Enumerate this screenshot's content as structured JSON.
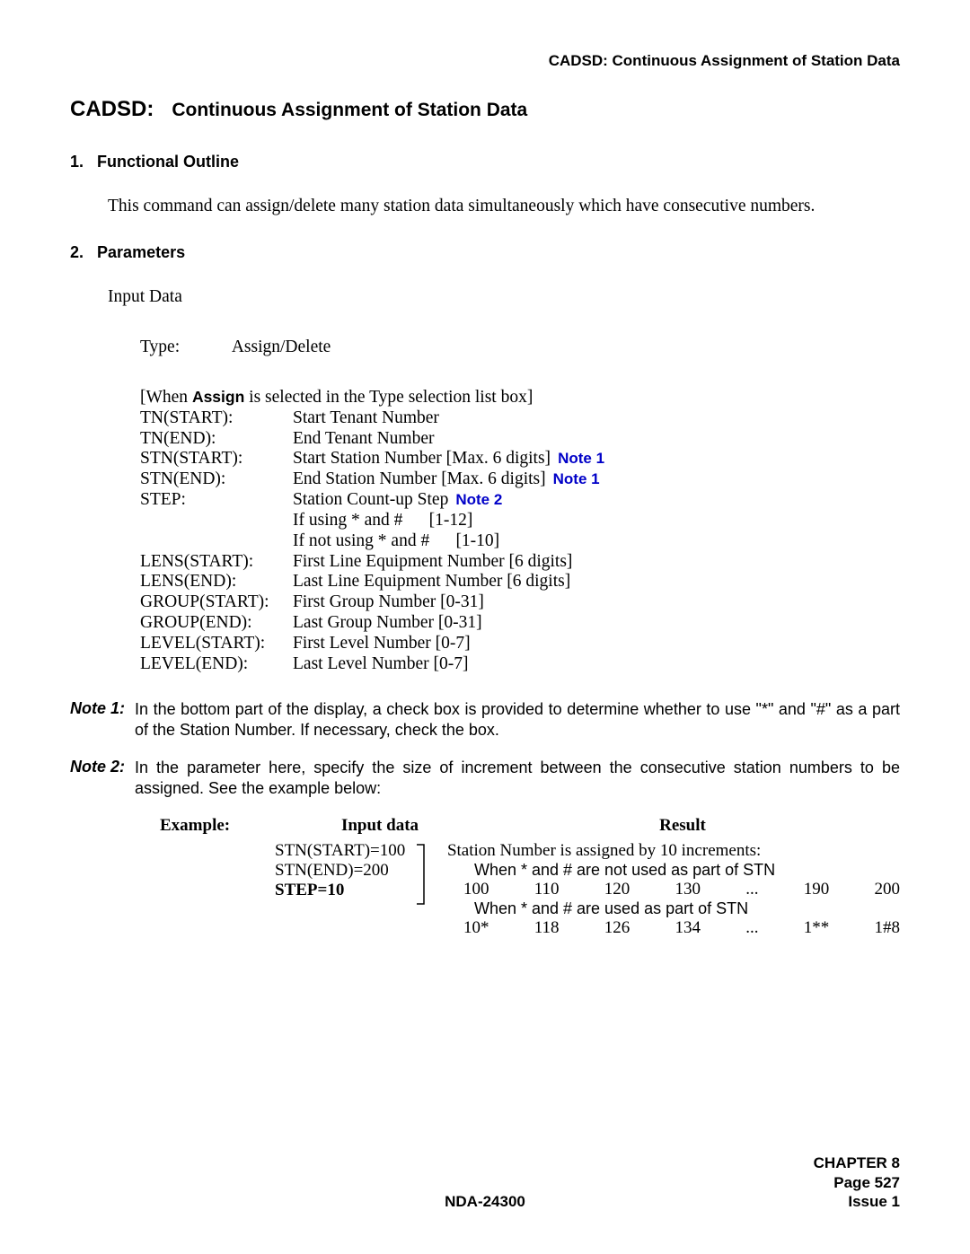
{
  "header": {
    "right": "CADSD: Continuous Assignment of Station Data"
  },
  "title": {
    "code": "CADSD:",
    "desc": "Continuous Assignment of Station Data"
  },
  "section1": {
    "num": "1.",
    "heading": "Functional Outline",
    "body": "This command can assign/delete many station data simultaneously which have consecutive numbers."
  },
  "section2": {
    "num": "2.",
    "heading": "Parameters",
    "input_label": "Input Data",
    "type_label": "Type:",
    "type_value": "Assign/Delete",
    "assign_line_prefix": "[When ",
    "assign_bold": "Assign",
    "assign_line_suffix": " is selected in the Type selection list box]"
  },
  "params": [
    {
      "name": "TN(START):",
      "desc": "Start Tenant Number",
      "note": ""
    },
    {
      "name": "TN(END):",
      "desc": "End Tenant Number",
      "note": ""
    },
    {
      "name": "STN(START):",
      "desc": "Start Station Number [Max. 6 digits]",
      "note": "Note 1"
    },
    {
      "name": "STN(END):",
      "desc": "End Station Number [Max. 6 digits]",
      "note": "Note 1"
    },
    {
      "name": "STEP:",
      "desc": "Station Count-up Step",
      "note": "Note 2"
    }
  ],
  "step_sub1": "If using * and #      [1-12]",
  "step_sub2": "If not using * and #      [1-10]",
  "params2": [
    {
      "name": "LENS(START):",
      "desc": "First Line Equipment Number [6 digits]"
    },
    {
      "name": "LENS(END):",
      "desc": "Last Line Equipment Number [6 digits]"
    },
    {
      "name": "GROUP(START):",
      "desc": "First Group Number [0-31]"
    },
    {
      "name": "GROUP(END):",
      "desc": "Last Group Number [0-31]"
    },
    {
      "name": "LEVEL(START):",
      "desc": "First Level Number [0-7]"
    },
    {
      "name": "LEVEL(END):",
      "desc": "Last Level Number [0-7]"
    }
  ],
  "note1": {
    "label": "Note 1:",
    "text": "In the bottom part of the display, a check box is provided to determine whether to use \"*\" and \"#\" as a part of the Station Number. If necessary, check the box."
  },
  "note2": {
    "label": "Note 2:",
    "text": "In the parameter here, specify the size of increment between the consecutive station numbers to be assigned. See the example below:"
  },
  "example": {
    "label": "Example:",
    "input_head": "Input data",
    "result_head": "Result",
    "input1": "STN(START)=100",
    "input2": "STN(END)=200",
    "input3": "STEP=10",
    "result_title": "Station Number is assigned by 10 increments:",
    "result_case1": "When * and # are not used as part of STN",
    "result_seq1": "100   110   120   130   ...   190   200",
    "result_case2": "When * and # are used as part of STN",
    "result_seq2": "10*   118   126   134   ...   1**   1#8"
  },
  "footer": {
    "center": "NDA-24300",
    "chapter": "CHAPTER 8",
    "page": "Page 527",
    "issue": "Issue 1"
  }
}
